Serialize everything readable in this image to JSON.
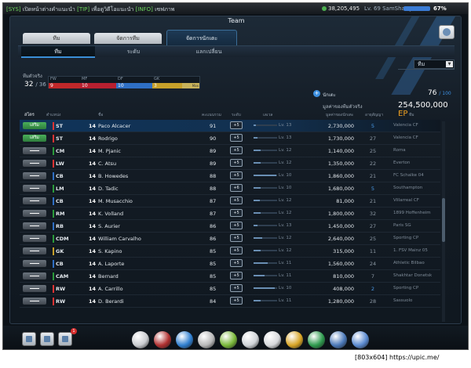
{
  "topbar": {
    "ticker_1_tag": "[SYS]",
    "ticker_1": "เปิดหน้าต่างคำแนะนำ",
    "ticker_2_tag": "[TIP]",
    "ticker_2": "เพื่อดูวิดีโอแนะนำ",
    "ticker_3_tag": "[INFO]",
    "ticker_3": "เซฟภาพ",
    "coins": "38,205,495",
    "level": "Lv. 69 SamShaDyz",
    "exp_percent": "67%"
  },
  "panel": {
    "title": "Team",
    "tabs": [
      "ทีม",
      "จัดการทีม",
      "จัดการนักเตะ"
    ],
    "subtabs": [
      "ทีม",
      "ระดับ",
      "แลกเปลี่ยน"
    ]
  },
  "summary": {
    "dropdown_value": "ทีม",
    "label": "ทีมตัวจริง",
    "count": "32",
    "count_max": "/ 36",
    "positions": [
      {
        "label": "FW",
        "count": "9",
        "color": "#c0282a"
      },
      {
        "label": "MF",
        "count": "10",
        "color": "#b82030"
      },
      {
        "label": "DF",
        "count": "10",
        "color": "#2f6fc4"
      },
      {
        "label": "GK",
        "count": "3",
        "color": "#c6a02a"
      }
    ],
    "pos_max_label": "Max",
    "add_label": "นักเตะ",
    "slots": "76",
    "slots_max": "/ 100",
    "value_label": "มูลค่าของทีมตัวจริง",
    "value": "254,500,000",
    "value_unit": "EP"
  },
  "table": {
    "headers": {
      "status": "สโตร",
      "pos": "ตำแหน่ง",
      "name": "ชื่อ",
      "ovr": "คะแนนรวม",
      "upg": "ระดับ",
      "lv": "เลเวล",
      "value": "มูลค่าของนักเตะ",
      "years": "อายุสัญญา",
      "club": "ทีม"
    },
    "status_on_label": "เสริม",
    "rows": [
      {
        "status": "on",
        "pos": "ST",
        "pcolor": "#d33",
        "season": "14",
        "name": "Paco Alcacer",
        "ovr": "91",
        "upg": "+5",
        "lvfill": 0.1,
        "lv": "Lv. 13",
        "value": "2,730,000",
        "years": "5",
        "yblue": true,
        "club": "Valencia CF",
        "hl": true
      },
      {
        "status": "on",
        "pos": "ST",
        "pcolor": "#d33",
        "season": "14",
        "name": "Rodrigo",
        "ovr": "90",
        "upg": "+5",
        "lvfill": 0.15,
        "lv": "Lv. 13",
        "value": "1,730,000",
        "years": "27",
        "yblue": false,
        "club": "Valencia CF"
      },
      {
        "status": "off",
        "pos": "CM",
        "pcolor": "#2a9a3a",
        "season": "14",
        "name": "M. Pjanic",
        "ovr": "89",
        "upg": "+5",
        "lvfill": 0.3,
        "lv": "Lv. 12",
        "value": "1,140,000",
        "years": "25",
        "yblue": false,
        "club": "Roma"
      },
      {
        "status": "off",
        "pos": "LW",
        "pcolor": "#d33",
        "season": "14",
        "name": "C. Atsu",
        "ovr": "89",
        "upg": "+5",
        "lvfill": 0.3,
        "lv": "Lv. 12",
        "value": "1,350,000",
        "years": "22",
        "yblue": false,
        "club": "Everton"
      },
      {
        "status": "off",
        "pos": "CB",
        "pcolor": "#2f6fc4",
        "season": "14",
        "name": "B. Howedes",
        "ovr": "88",
        "upg": "+5",
        "lvfill": 0.95,
        "lv": "Lv. 10",
        "value": "1,860,000",
        "years": "21",
        "yblue": false,
        "club": "FC Schalke 04"
      },
      {
        "status": "off",
        "pos": "LM",
        "pcolor": "#2a9a3a",
        "season": "14",
        "name": "D. Tadic",
        "ovr": "88",
        "upg": "+6",
        "lvfill": 0.3,
        "lv": "Lv. 10",
        "value": "1,680,000",
        "years": "5",
        "yblue": true,
        "club": "Southampton"
      },
      {
        "status": "off",
        "pos": "CB",
        "pcolor": "#2f6fc4",
        "season": "14",
        "name": "M. Musacchio",
        "ovr": "87",
        "upg": "+5",
        "lvfill": 0.25,
        "lv": "Lv. 12",
        "value": "81,000",
        "years": "21",
        "yblue": false,
        "club": "Villarreal CF"
      },
      {
        "status": "off",
        "pos": "RM",
        "pcolor": "#2a9a3a",
        "season": "14",
        "name": "K. Volland",
        "ovr": "87",
        "upg": "+5",
        "lvfill": 0.3,
        "lv": "Lv. 12",
        "value": "1,800,000",
        "years": "32",
        "yblue": false,
        "club": "1899 Hoffenheim"
      },
      {
        "status": "off",
        "pos": "RB",
        "pcolor": "#2f6fc4",
        "season": "14",
        "name": "S. Aurier",
        "ovr": "86",
        "upg": "+5",
        "lvfill": 0.15,
        "lv": "Lv. 13",
        "value": "1,450,000",
        "years": "27",
        "yblue": false,
        "club": "Paris SG"
      },
      {
        "status": "off",
        "pos": "CDM",
        "pcolor": "#2a9a3a",
        "season": "14",
        "name": "William Carvalho",
        "ovr": "86",
        "upg": "+5",
        "lvfill": 0.35,
        "lv": "Lv. 12",
        "value": "2,640,000",
        "years": "25",
        "yblue": false,
        "club": "Sporting CP"
      },
      {
        "status": "off",
        "pos": "GK",
        "pcolor": "#c6a02a",
        "season": "14",
        "name": "S. Kapino",
        "ovr": "85",
        "upg": "+5",
        "lvfill": 0.3,
        "lv": "Lv. 12",
        "value": "315,000",
        "years": "11",
        "yblue": false,
        "club": "1. FSV Mainz 05"
      },
      {
        "status": "off",
        "pos": "CB",
        "pcolor": "#2f6fc4",
        "season": "14",
        "name": "A. Laporte",
        "ovr": "85",
        "upg": "+5",
        "lvfill": 0.6,
        "lv": "Lv. 11",
        "value": "1,560,000",
        "years": "24",
        "yblue": false,
        "club": "Athletic Bilbao"
      },
      {
        "status": "off",
        "pos": "CAM",
        "pcolor": "#2a9a3a",
        "season": "14",
        "name": "Bernard",
        "ovr": "85",
        "upg": "+5",
        "lvfill": 0.45,
        "lv": "Lv. 11",
        "value": "810,000",
        "years": "7",
        "yblue": false,
        "club": "Shakhtar Donetsk"
      },
      {
        "status": "off",
        "pos": "RW",
        "pcolor": "#d33",
        "season": "14",
        "name": "A. Carrillo",
        "ovr": "85",
        "upg": "+5",
        "lvfill": 0.9,
        "lv": "Lv. 10",
        "value": "408,000",
        "years": "2",
        "yblue": true,
        "club": "Sporting CP"
      },
      {
        "status": "off",
        "pos": "RW",
        "pcolor": "#d33",
        "season": "14",
        "name": "D. Berardi",
        "ovr": "84",
        "upg": "+5",
        "lvfill": 0.3,
        "lv": "Lv. 11",
        "value": "1,280,000",
        "years": "28",
        "yblue": false,
        "club": "Sassuolo"
      }
    ]
  },
  "dock": {
    "notification_count": "1",
    "game_icons": [
      {
        "name": "whistle-icon",
        "color": "#c9ccd0"
      },
      {
        "name": "ball-shirt-icon",
        "color": "#b03030"
      },
      {
        "name": "boots-icon",
        "color": "#2f7fd0"
      },
      {
        "name": "trophy-icon",
        "color": "#b8b8b8"
      },
      {
        "name": "pyramid-icon",
        "color": "#7ab83a"
      },
      {
        "name": "cards-icon",
        "color": "#d0d4d8"
      },
      {
        "name": "ticket-icon",
        "color": "#d7d9dc"
      },
      {
        "name": "coin-icon",
        "color": "#d8a526"
      },
      {
        "name": "ep-badge-icon",
        "color": "#2e9a4e"
      },
      {
        "name": "scout-icon",
        "color": "#4a78b8"
      },
      {
        "name": "cart-icon",
        "color": "#5a8ad0"
      }
    ]
  },
  "watermark": "[803x604] https://upic.me/"
}
